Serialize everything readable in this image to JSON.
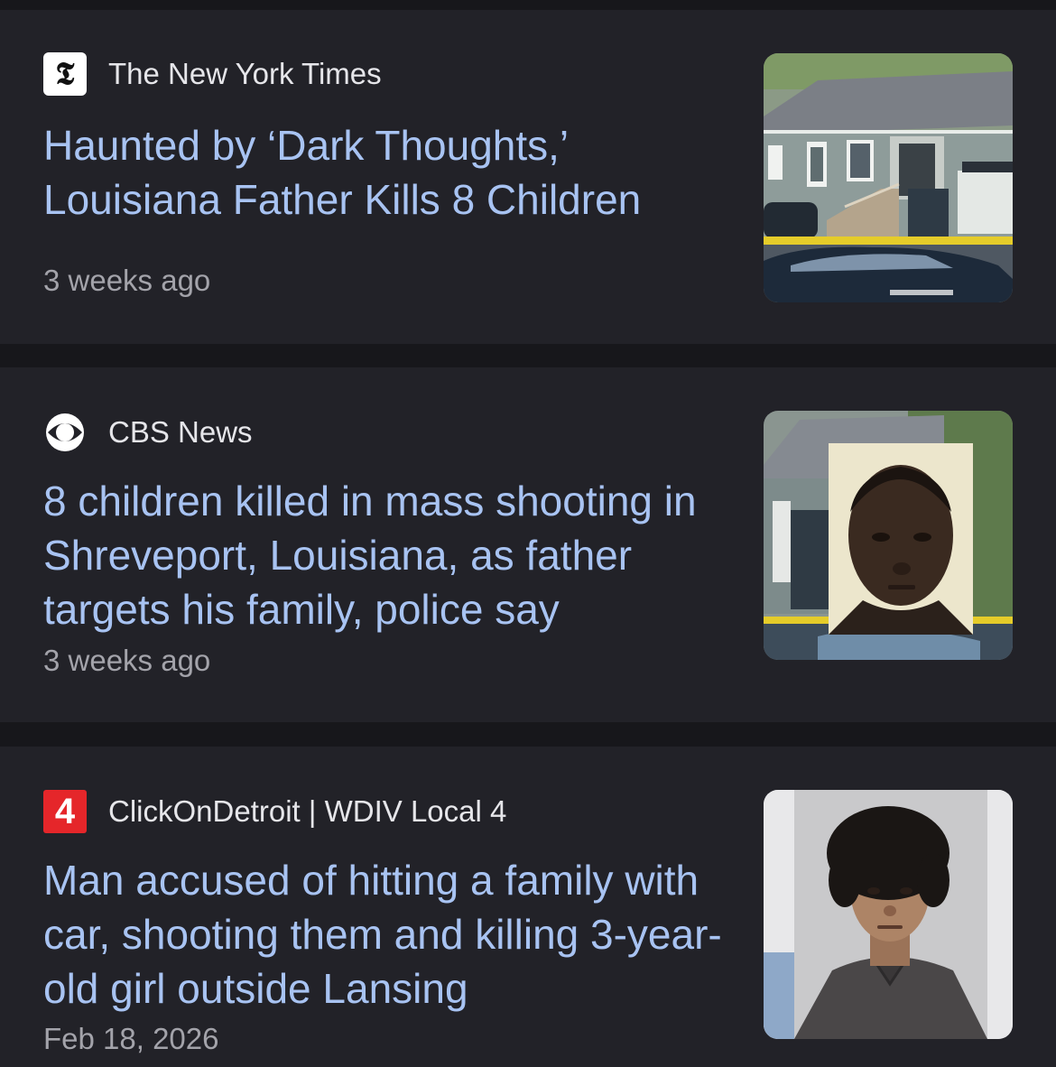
{
  "articles": [
    {
      "source": "The New York Times",
      "logo_icon": "nyt-logo-icon",
      "logo_glyph": "𝕿",
      "headline": "Haunted by ‘Dark Thoughts,’ Louisiana Father Kills 8 Children",
      "time": "3 weeks ago",
      "thumbnail": "house-crime-scene-thumbnail"
    },
    {
      "source": "CBS News",
      "logo_icon": "cbs-eye-logo-icon",
      "headline": "8 children killed in mass shooting in Shreveport, Louisiana, as father targets his family, police say",
      "time": "3 weeks ago",
      "thumbnail": "suspect-mugshot-over-house-thumbnail"
    },
    {
      "source": "ClickOnDetroit | WDIV Local 4",
      "logo_icon": "wdiv-local4-logo-icon",
      "logo_glyph": "4",
      "headline": "Man accused of hitting a family with car, shooting them and killing 3-year-old girl outside Lansing",
      "time": "Feb 18, 2026",
      "thumbnail": "suspect-mugshot-thumbnail"
    }
  ],
  "colors": {
    "background": "#17171b",
    "card": "#222228",
    "headline": "#a8c3f2",
    "source": "#e6e6ea",
    "timestamp": "#a3a3aa",
    "wdiv_red": "#e5262a"
  }
}
